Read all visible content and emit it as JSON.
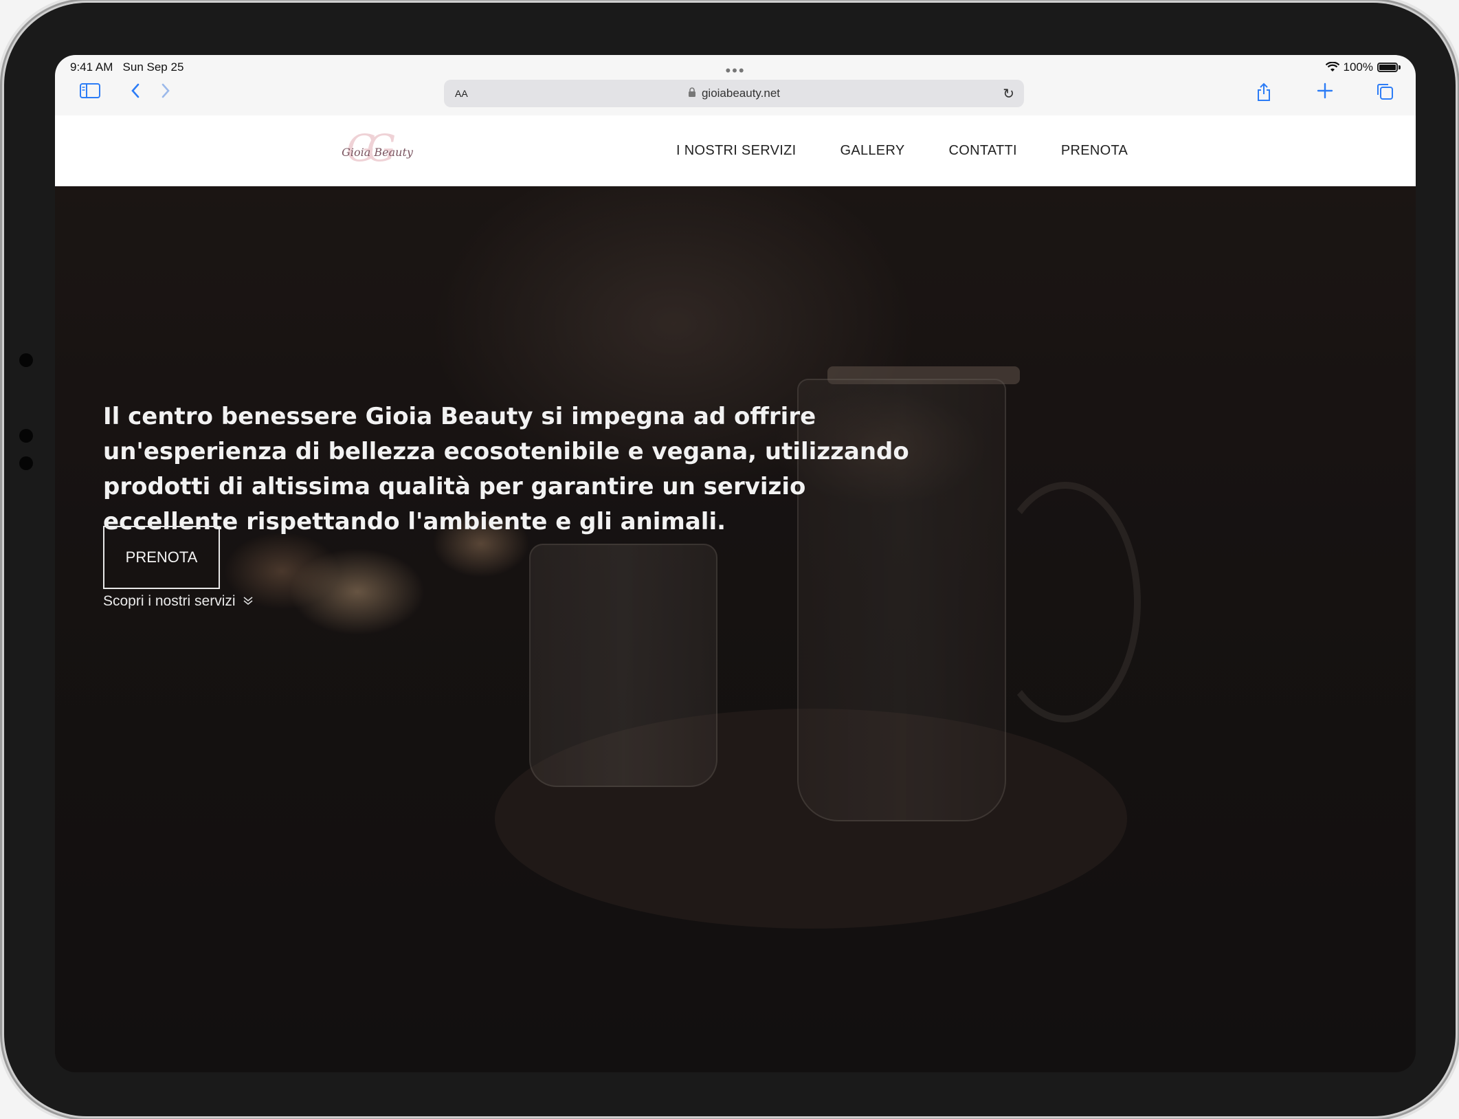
{
  "status_bar": {
    "time": "9:41 AM",
    "date": "Sun Sep 25",
    "battery": "100%"
  },
  "browser": {
    "text_size_label": "AA",
    "url": "gioiabeauty.net",
    "icons": {
      "sidebar": "sidebar-icon",
      "back": "chevron-left-icon",
      "forward": "chevron-right-icon",
      "lock": "lock-icon",
      "reload": "reload-icon",
      "share": "share-icon",
      "new_tab": "plus-icon",
      "tabs": "tabs-icon"
    },
    "accent_color": "#2c7cf6"
  },
  "site": {
    "logo_text": "Gioia Beauty",
    "nav": [
      "I NOSTRI SERVIZI",
      "GALLERY",
      "CONTATTI",
      "PRENOTA"
    ]
  },
  "hero": {
    "headline": "Il centro benessere Gioia Beauty si impegna ad offrire un'esperienza di bellezza ecosotenibile e vegana, utilizzando prodotti di altissima qualità per garantire un servizio eccellente rispettando l'ambiente e gli animali.",
    "cta_label": "PRENOTA",
    "discover_label": "Scopri i nostri servizi"
  }
}
